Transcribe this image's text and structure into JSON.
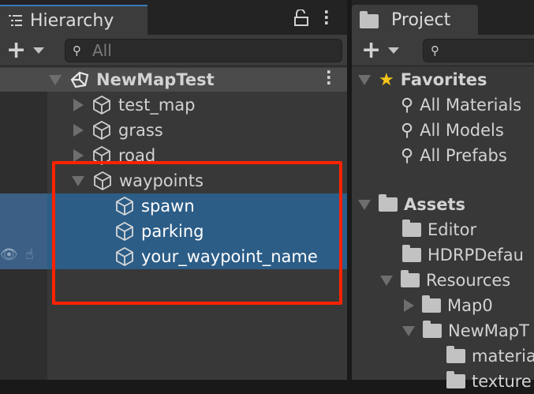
{
  "hierarchy": {
    "tab_label": "Hierarchy",
    "search_placeholder": "All",
    "scene": "NewMapTest",
    "items": [
      {
        "label": "test_map",
        "expanded": false
      },
      {
        "label": "grass",
        "expanded": false
      },
      {
        "label": "road",
        "expanded": false
      },
      {
        "label": "waypoints",
        "expanded": true,
        "children": [
          {
            "label": "spawn",
            "selected": true
          },
          {
            "label": "parking",
            "selected": true
          },
          {
            "label": "your_waypoint_name",
            "selected": true
          }
        ]
      }
    ]
  },
  "project": {
    "tab_label": "Project",
    "favorites": {
      "label": "Favorites",
      "items": [
        "All Materials",
        "All Models",
        "All Prefabs"
      ]
    },
    "assets": {
      "label": "Assets",
      "items": [
        "Editor",
        "HDRPDefau",
        "Resources",
        "Map0",
        "NewMapT",
        "materia",
        "texture"
      ]
    }
  },
  "colors": {
    "selection": "#2c5d87",
    "highlight_box": "#ff2200",
    "favorite_star": "#f5c518",
    "active_tab_accent": "#3a79bb"
  }
}
